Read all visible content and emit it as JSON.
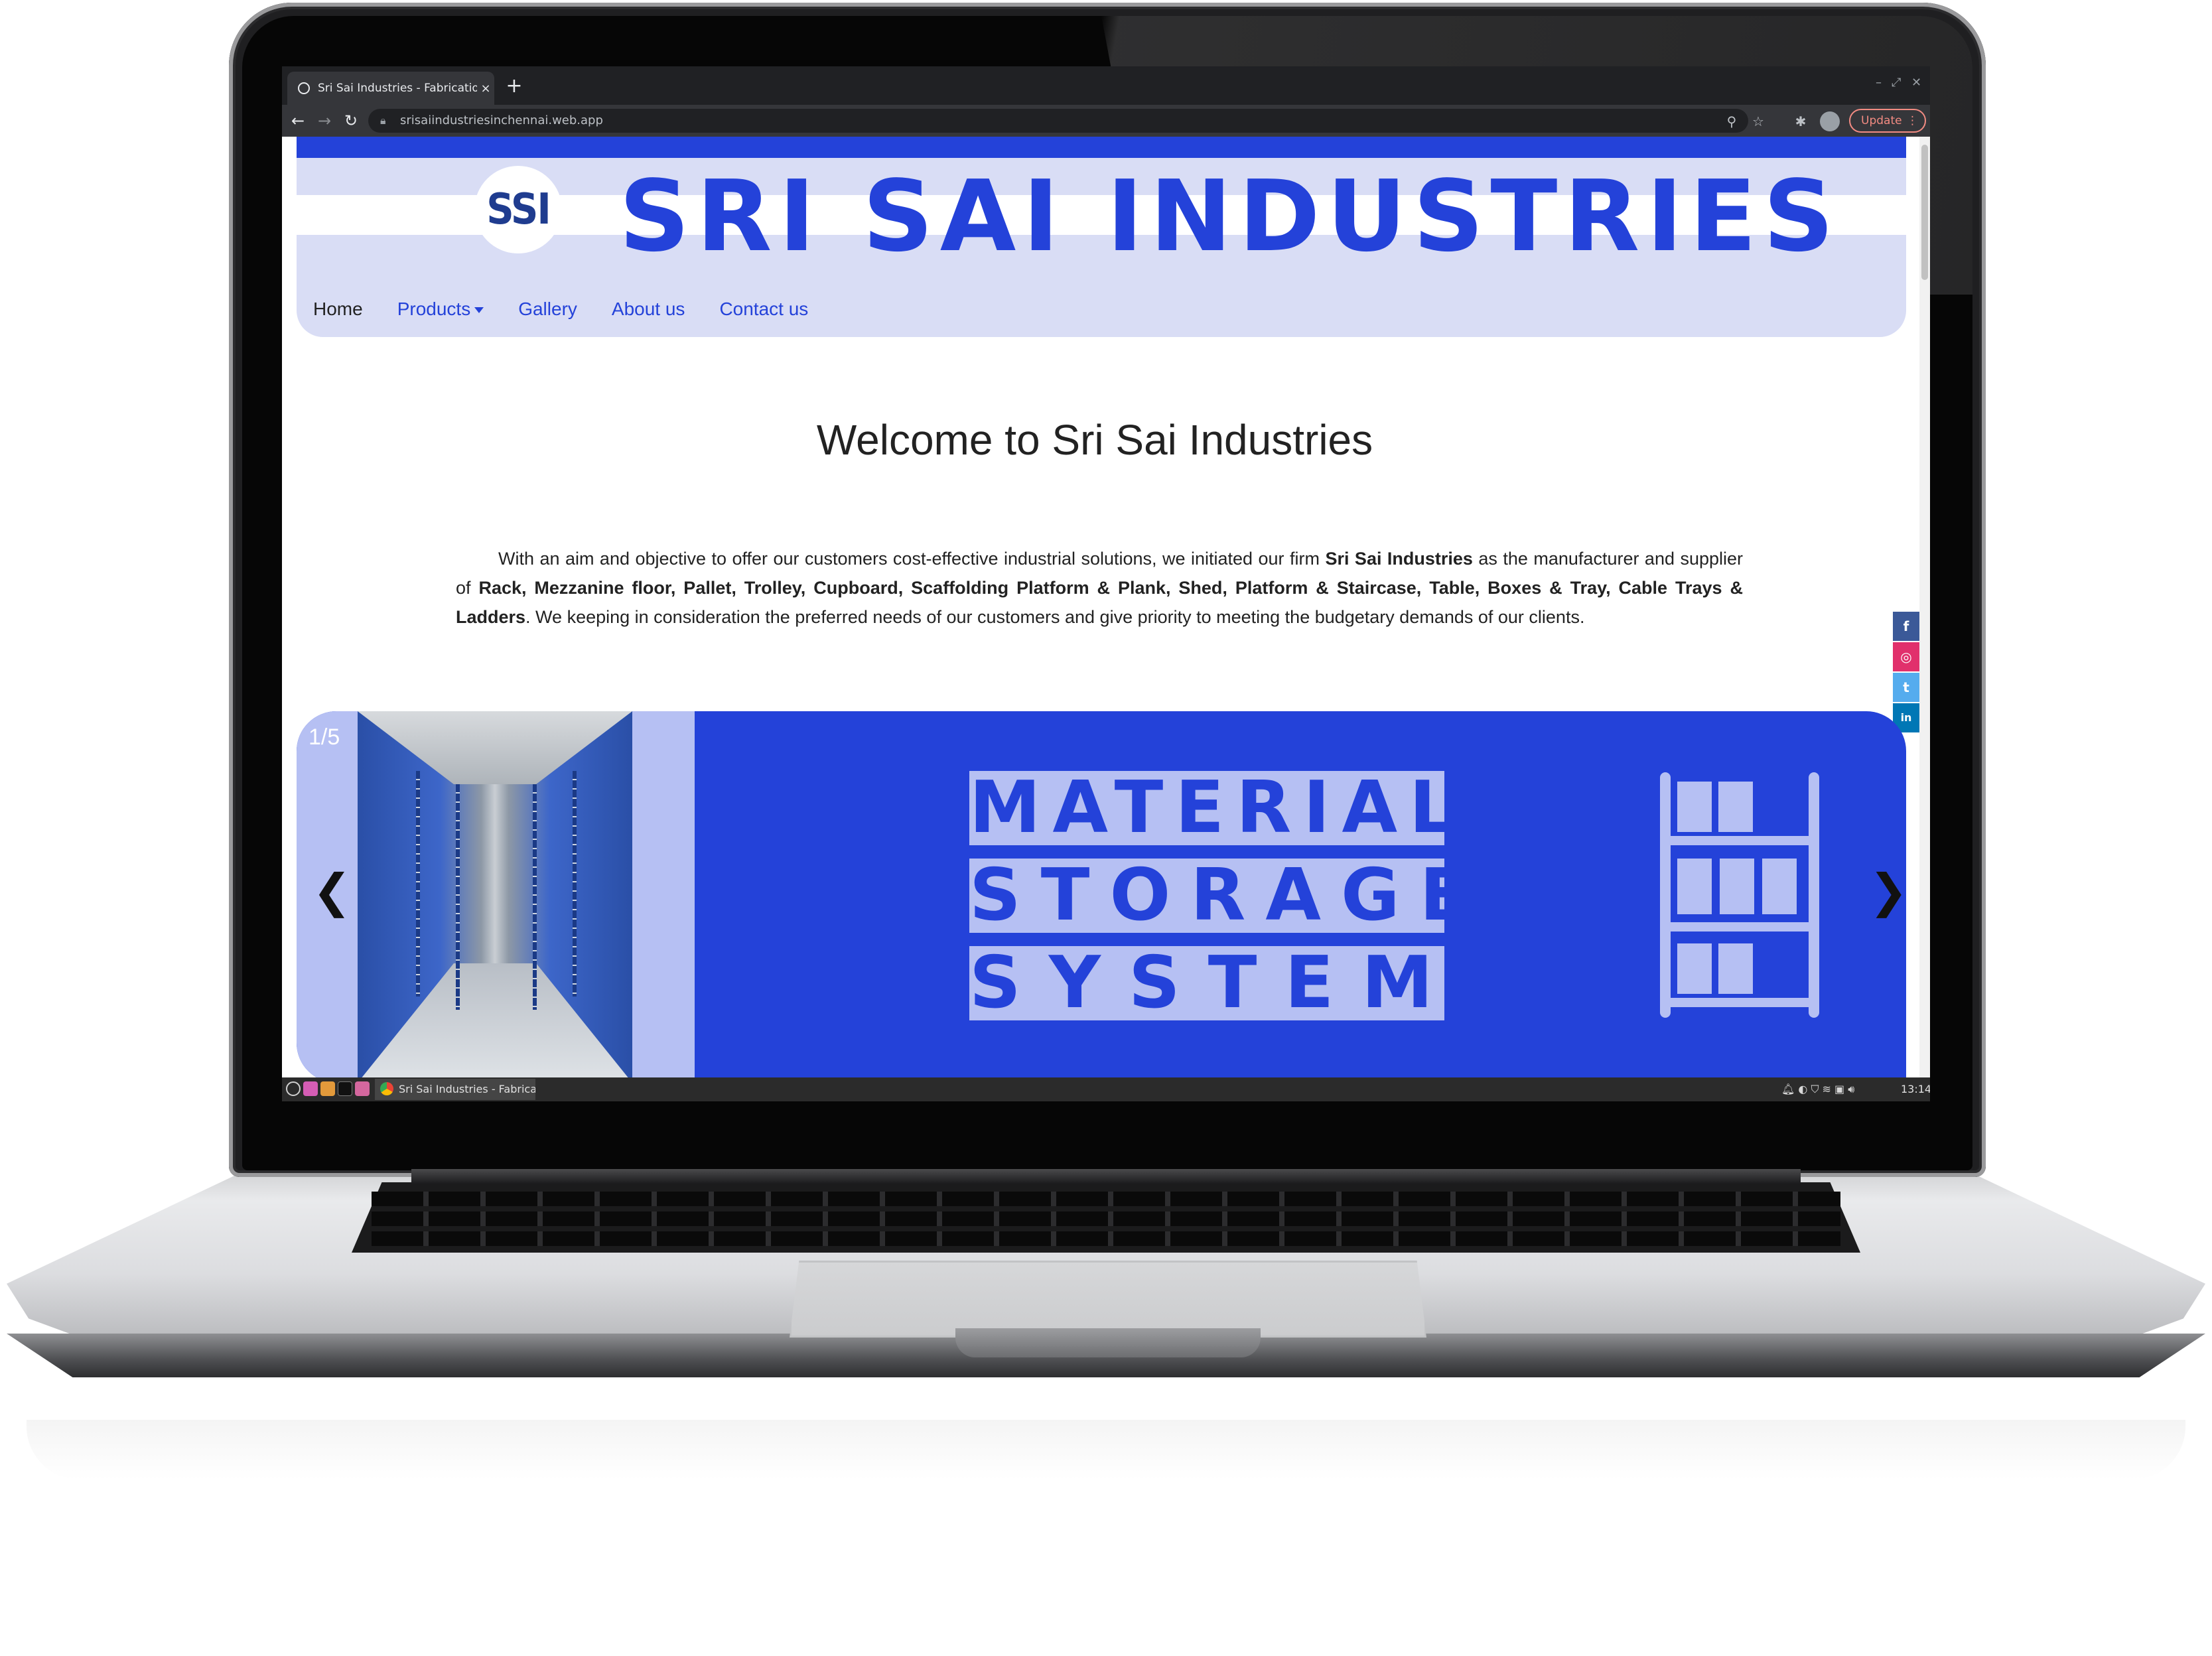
{
  "browser": {
    "tab_title": "Sri Sai Industries - Fabrication",
    "tab_close": "×",
    "new_tab": "+",
    "url": "srisaiindustriesinchennai.web.app",
    "update_label": "Update",
    "update_menu": "⋮",
    "win_min": "–",
    "win_max": "⤢",
    "win_close": "✕"
  },
  "site": {
    "logo_text": "SSI",
    "brand": "SRI SAI INDUSTRIES",
    "nav": {
      "home": "Home",
      "products": "Products",
      "gallery": "Gallery",
      "about": "About us",
      "contact": "Contact us"
    },
    "welcome": "Welcome to Sri Sai Industries",
    "intro": {
      "p1": "With an aim and objective to offer our customers cost-effective industrial solutions, we initiated our firm ",
      "firm": "Sri Sai Industries",
      "p2": " as the manufacturer and supplier of ",
      "products": "Rack, Mezzanine floor, Pallet, Trolley, Cupboard, Scaffolding Platform & Plank, Shed, Platform & Staircase, Table, Boxes & Tray, Cable Trays & Ladders",
      "p3": ". We keeping in consideration the preferred needs of our customers and give priority to meeting the budgetary demands of our clients."
    },
    "social": {
      "facebook": "f",
      "instagram": "◎",
      "twitter": "t",
      "linkedin": "in"
    },
    "slideshow": {
      "counter": "1/5",
      "prev": "❮",
      "next": "❯",
      "line1": "MATERIAL",
      "line2": "STORAGE",
      "line3": "SYSTEM"
    }
  },
  "taskbar": {
    "window_title": "Sri Sai Industries - Fabricati...",
    "clock": "13:14"
  },
  "colors": {
    "brand_blue": "#2442d9",
    "light_blue": "#d9ddf5",
    "slide_light": "#b6c0f3",
    "facebook": "#3b5998",
    "instagram": "#e1306c",
    "twitter": "#55acee",
    "linkedin": "#0077b5"
  }
}
